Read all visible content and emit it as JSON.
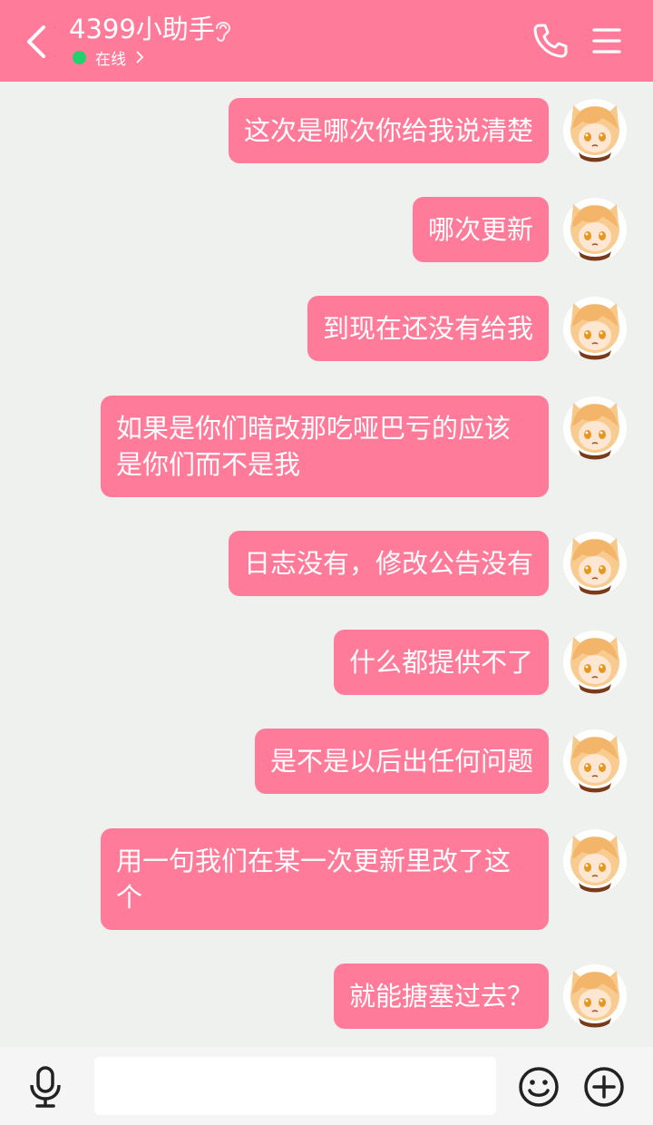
{
  "header": {
    "title": "4399小助手",
    "status": "在线"
  },
  "messages": [
    {
      "text": "这次是哪次你给我说清楚"
    },
    {
      "text": "哪次更新"
    },
    {
      "text": "到现在还没有给我"
    },
    {
      "text": "如果是你们暗改那吃哑巴亏的应该是你们而不是我"
    },
    {
      "text": "日志没有，修改公告没有"
    },
    {
      "text": "什么都提供不了"
    },
    {
      "text": "是不是以后出任何问题"
    },
    {
      "text": "用一句我们在某一次更新里改了这个"
    },
    {
      "text": "就能搪塞过去？"
    }
  ],
  "input": {
    "value": "",
    "placeholder": ""
  },
  "colors": {
    "header_bg": "#ff7b99",
    "bubble_bg": "#ff7b99",
    "chat_bg": "#eef1ee",
    "online_dot": "#21d16b"
  },
  "icons": [
    "back-arrow-icon",
    "ear-icon",
    "chevron-right-icon",
    "phone-icon",
    "menu-icon",
    "microphone-icon",
    "emoji-icon",
    "plus-icon"
  ]
}
